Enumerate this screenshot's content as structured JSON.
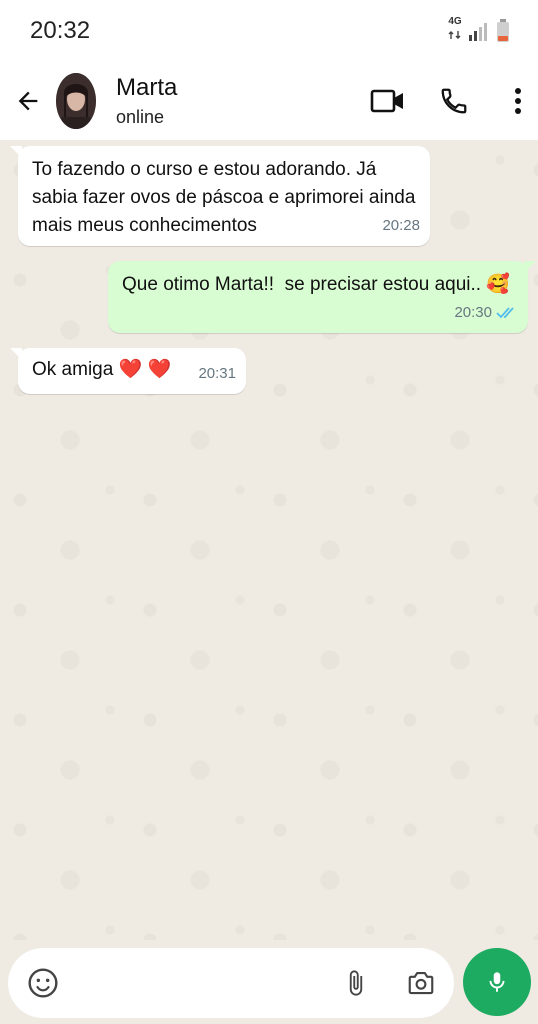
{
  "status_bar": {
    "time": "20:32",
    "network": "4G"
  },
  "header": {
    "contact_name": "Marta",
    "contact_status": "online"
  },
  "messages": [
    {
      "direction": "in",
      "text": "To fazendo o curso e estou adorando. Já sabia fazer ovos de páscoa e aprimorei ainda mais meus conhecimentos",
      "time": "20:28"
    },
    {
      "direction": "out",
      "text": "Que otimo Marta!!  se precisar estou aqui.. 🥰",
      "time": "20:30",
      "read": true
    },
    {
      "direction": "in",
      "text": "Ok amiga ❤️ ❤️",
      "time": "20:31"
    }
  ],
  "composer": {
    "placeholder": "",
    "value": ""
  },
  "colors": {
    "outgoing_bubble": "#d9fdd3",
    "incoming_bubble": "#ffffff",
    "chat_background": "#efeae2",
    "mic_button": "#1daa61",
    "read_ticks": "#53bdeb"
  },
  "icons": {
    "back": "arrow-left-icon",
    "video": "video-camera-icon",
    "call": "phone-icon",
    "menu": "more-vertical-icon",
    "emoji": "emoji-icon",
    "attach": "paperclip-icon",
    "camera": "camera-icon",
    "mic": "microphone-icon"
  }
}
